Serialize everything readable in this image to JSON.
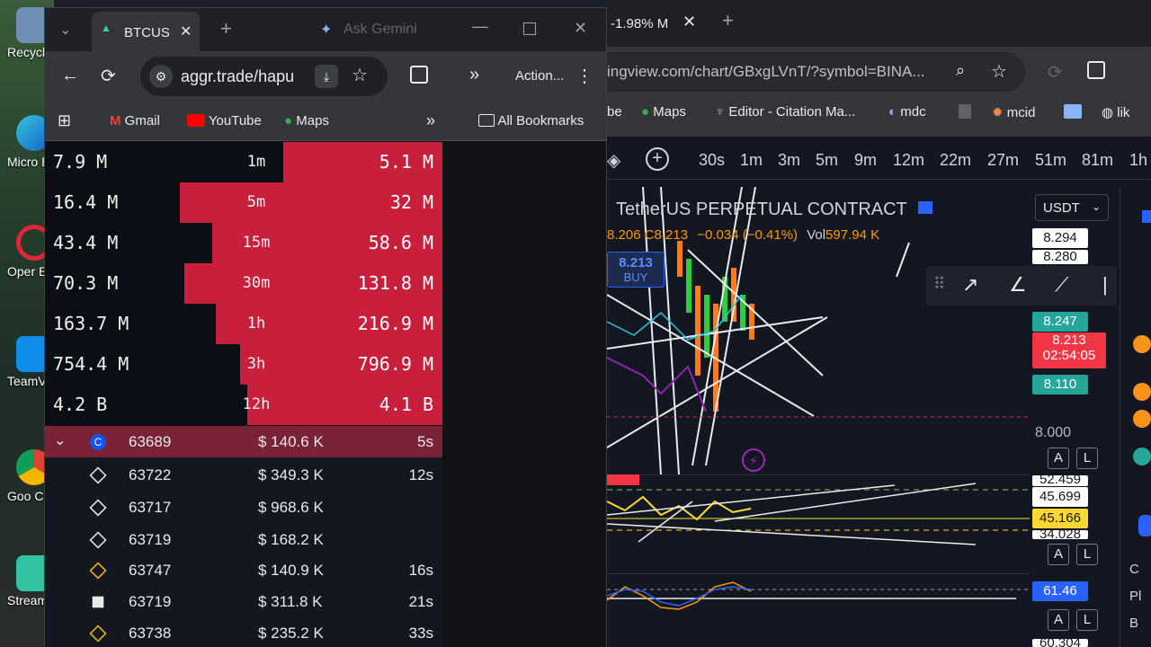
{
  "desktop": {
    "icons": [
      {
        "label": "Recycl",
        "icon": "recycle-bin-icon"
      },
      {
        "label": "Micro Edg",
        "icon": "edge-icon"
      },
      {
        "label": "Oper Brow",
        "icon": "opera-icon"
      },
      {
        "label": "TeamV",
        "icon": "teamviewer-icon"
      },
      {
        "label": "Goo Chro",
        "icon": "chrome-icon"
      },
      {
        "label": "Stream",
        "icon": "streamlabs-icon"
      }
    ]
  },
  "aggr_window": {
    "tab_title": "BTCUSI",
    "ask_gemini": "Ask Gemini",
    "url": "aggr.trade/hapu",
    "actions_label": "Action...",
    "bookmarks": [
      "Gmail",
      "YouTube",
      "Maps"
    ],
    "all_bookmarks": "All Bookmarks",
    "stats": [
      {
        "left": "7.9 M",
        "interval": "1m",
        "right": "5.1 M",
        "bar_fraction": 0.4
      },
      {
        "left": "16.4 M",
        "interval": "5m",
        "right": "32 M",
        "bar_fraction": 0.66
      },
      {
        "left": "43.4 M",
        "interval": "15m",
        "right": "58.6 M",
        "bar_fraction": 0.58
      },
      {
        "left": "70.3 M",
        "interval": "30m",
        "right": "131.8 M",
        "bar_fraction": 0.65
      },
      {
        "left": "163.7 M",
        "interval": "1h",
        "right": "216.9 M",
        "bar_fraction": 0.57
      },
      {
        "left": "754.4 M",
        "interval": "3h",
        "right": "796.9 M",
        "bar_fraction": 0.51
      },
      {
        "left": "4.2 B",
        "interval": "12h",
        "right": "4.1 B",
        "bar_fraction": 0.49
      }
    ],
    "trades": [
      {
        "price": "63689",
        "amount": "$ 140.6 K",
        "time": "5s",
        "exchange": "coinbase",
        "highlight": true
      },
      {
        "price": "63722",
        "amount": "$ 349.3 K",
        "time": "12s",
        "exchange": "binance-white"
      },
      {
        "price": "63717",
        "amount": "$ 968.6 K",
        "time": "",
        "exchange": "binance-white"
      },
      {
        "price": "63719",
        "amount": "$ 168.2 K",
        "time": "",
        "exchange": "binance-white"
      },
      {
        "price": "63747",
        "amount": "$ 140.9 K",
        "time": "16s",
        "exchange": "binance-yellow"
      },
      {
        "price": "63719",
        "amount": "$ 311.8 K",
        "time": "21s",
        "exchange": "okx"
      },
      {
        "price": "63738",
        "amount": "$ 235.2 K",
        "time": "33s",
        "exchange": "binance-yellow"
      }
    ]
  },
  "tv_window": {
    "tab_title": "-1.98% M",
    "url": "ingview.com/chart/GBxgLVnT/?symbol=BINA...",
    "bookmarks": [
      "be",
      "Maps",
      "Editor - Citation Ma...",
      "mdc",
      "mcid",
      "lik"
    ],
    "intervals": [
      "30s",
      "1m",
      "3m",
      "5m",
      "9m",
      "12m",
      "22m",
      "27m",
      "51m",
      "81m",
      "1h"
    ],
    "symbol_title": "TetherUS PERPETUAL CONTRACT",
    "ohlc": {
      "o": "8.206",
      "c": "C8.213",
      "change": "−0.034 (−0.41%)",
      "vol_label": "Vol",
      "vol": "597.94 K"
    },
    "buy_price": "8.213",
    "buy_label": "BUY",
    "currency": "USDT",
    "prices": {
      "p1": "8.294",
      "p2": "8.280",
      "p3": "8.247",
      "current": "8.213",
      "countdown": "02:54:05",
      "p4": "8.110",
      "p5": "8.000",
      "ind1": "52.459",
      "ind2": "45.699",
      "ind3": "45.166",
      "ind4": "34.028",
      "osc": "61.46",
      "bottom": "60.304"
    },
    "btn_a": "A",
    "btn_l": "L",
    "sidebar_letters": [
      "C",
      "Pl",
      "B"
    ],
    "colors": {
      "up": "#26a69a",
      "down": "#f7525f",
      "accent": "#2962ff",
      "highlight": "#f23645"
    }
  }
}
